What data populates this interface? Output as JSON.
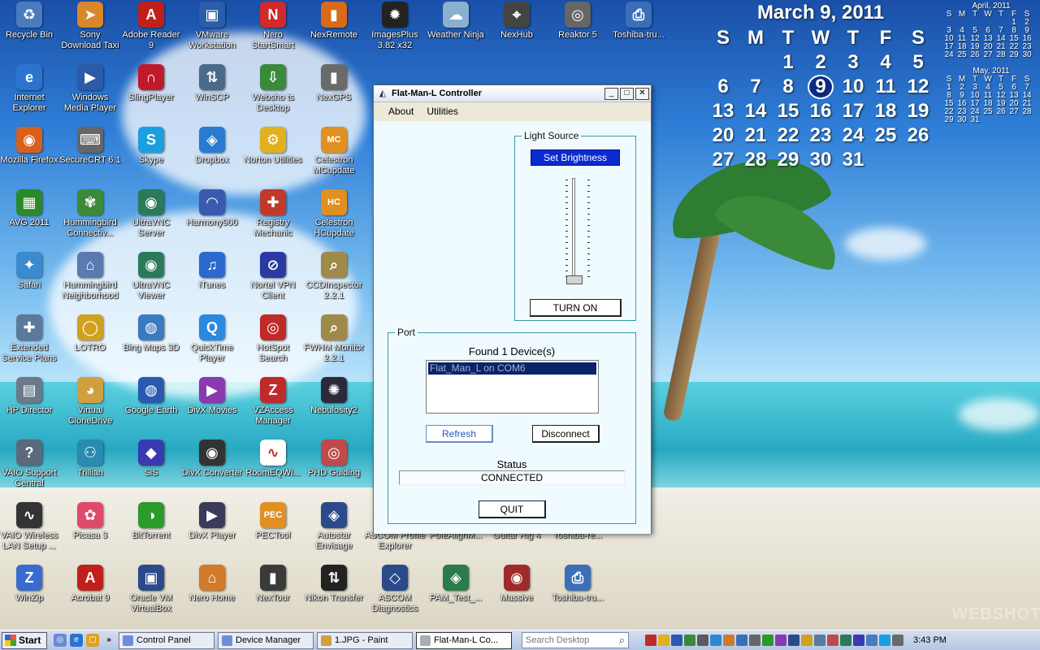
{
  "desktop": {
    "icons": [
      {
        "label": "Recycle Bin",
        "symbol": "♻",
        "color": "#4a7bbf"
      },
      {
        "label": "Sony Download Taxi",
        "symbol": "➤",
        "color": "#d8872a"
      },
      {
        "label": "Adobe Reader 9",
        "symbol": "A",
        "color": "#c0201b"
      },
      {
        "label": "VMware Workstation",
        "symbol": "▣",
        "color": "#2a5ea8"
      },
      {
        "label": "Nero StartSmart",
        "symbol": "N",
        "color": "#d02a2a"
      },
      {
        "label": "NexRemote",
        "symbol": "▮",
        "color": "#d86a1a"
      },
      {
        "label": "ImagesPlus 3.82 x32",
        "symbol": "✹",
        "color": "#222"
      },
      {
        "label": "Weather Ninja",
        "symbol": "☁",
        "color": "#8ab0d0"
      },
      {
        "label": "NexHub",
        "symbol": "⌖",
        "color": "#444"
      },
      {
        "label": "Reaktor 5",
        "symbol": "◎",
        "color": "#666"
      },
      {
        "label": "Toshiba-tru...",
        "symbol": "⎙",
        "color": "#3a6fb8"
      },
      {
        "label": "Internet Explorer",
        "symbol": "e",
        "color": "#2a74d0"
      },
      {
        "label": "Windows Media Player",
        "symbol": "▶",
        "color": "#2a5aa8"
      },
      {
        "label": "SlingPlayer",
        "symbol": "∩",
        "color": "#c01a2a"
      },
      {
        "label": "WinSCP",
        "symbol": "⇅",
        "color": "#4a6a8a"
      },
      {
        "label": "Websho ts Desktop",
        "symbol": "⇩",
        "color": "#3a8a3a"
      },
      {
        "label": "NexGPS",
        "symbol": "▮",
        "color": "#6a6a6a"
      },
      {
        "label": "Mozilla Firefox",
        "symbol": "◉",
        "color": "#d8601a"
      },
      {
        "label": "SecureCRT 6.1",
        "symbol": "⌨",
        "color": "#666"
      },
      {
        "label": "Skype",
        "symbol": "S",
        "color": "#1aa0e0"
      },
      {
        "label": "Dropbox",
        "symbol": "◈",
        "color": "#2a7ad0"
      },
      {
        "label": "Norton Utilities",
        "symbol": "⚙",
        "color": "#e0b020"
      },
      {
        "label": "Celestron MCupdate",
        "symbol": "MC",
        "color": "#e09020"
      },
      {
        "label": "AVG 2011",
        "symbol": "▦",
        "color": "#2a8a2a"
      },
      {
        "label": "Hummingbird Connectiv...",
        "symbol": "✾",
        "color": "#3a8a3a"
      },
      {
        "label": "UltraVNC Server",
        "symbol": "◉",
        "color": "#2a7a5a"
      },
      {
        "label": "Harmony900",
        "symbol": "◠",
        "color": "#3a5ab0"
      },
      {
        "label": "Registry Mechanic",
        "symbol": "✚",
        "color": "#c03a2a"
      },
      {
        "label": "Celestron HCupdate",
        "symbol": "HC",
        "color": "#e09020"
      },
      {
        "label": "Safari",
        "symbol": "✦",
        "color": "#3a8ad0"
      },
      {
        "label": "Hummingbird Neighborhood",
        "symbol": "⌂",
        "color": "#5a7ab0"
      },
      {
        "label": "UltraVNC Viewer",
        "symbol": "◉",
        "color": "#2a7a5a"
      },
      {
        "label": "iTunes",
        "symbol": "♫",
        "color": "#2a6ad0"
      },
      {
        "label": "Nortel VPN Client",
        "symbol": "⊘",
        "color": "#2a3aa0"
      },
      {
        "label": "CCDInspector 2.2.1",
        "symbol": "⌕",
        "color": "#a08a4a"
      },
      {
        "label": "Extended Service Plans",
        "symbol": "✚",
        "color": "#5a7a9a"
      },
      {
        "label": "LOTRO",
        "symbol": "◯",
        "color": "#d0a020"
      },
      {
        "label": "Bing Maps 3D",
        "symbol": "◍",
        "color": "#3a7ac0"
      },
      {
        "label": "QuickTime Player",
        "symbol": "Q",
        "color": "#2a8ae0"
      },
      {
        "label": "HotSpot Search",
        "symbol": "◎",
        "color": "#c02a2a"
      },
      {
        "label": "FWHM Monitor 2.2.1",
        "symbol": "⌕",
        "color": "#a08a4a"
      },
      {
        "label": "HP Director",
        "symbol": "▤",
        "color": "#6a7a8a"
      },
      {
        "label": "Virtual CloneDrive",
        "symbol": "◕",
        "color": "#d0a040"
      },
      {
        "label": "Google Earth",
        "symbol": "◍",
        "color": "#2a5ab0"
      },
      {
        "label": "DivX Movies",
        "symbol": "▶",
        "color": "#8a3ab0"
      },
      {
        "label": "VZAccess Manager",
        "symbol": "Z",
        "color": "#c02a2a"
      },
      {
        "label": "Nebulosity2",
        "symbol": "✺",
        "color": "#2a2a3a"
      },
      {
        "label": "VAIO Support Central",
        "symbol": "?",
        "color": "#5a6a7a"
      },
      {
        "label": "Trillian",
        "symbol": "⚇",
        "color": "#2a8ab0"
      },
      {
        "label": "SiS",
        "symbol": "◆",
        "color": "#3a3ab0"
      },
      {
        "label": "DivX Converter",
        "symbol": "◉",
        "color": "#333"
      },
      {
        "label": "RoomEQWi...",
        "symbol": "∿",
        "color": "#fff"
      },
      {
        "label": "PHD Guiding",
        "symbol": "◎",
        "color": "#c04a4a"
      },
      {
        "label": "VAIO Wireless LAN Setup ...",
        "symbol": "∿",
        "color": "#333"
      },
      {
        "label": "Picasa 3",
        "symbol": "✿",
        "color": "#e04a6a"
      },
      {
        "label": "BitTorrent",
        "symbol": "◑",
        "color": "#2a9a2a"
      },
      {
        "label": "DivX Player",
        "symbol": "▶",
        "color": "#3a3a5a"
      },
      {
        "label": "PECTool",
        "symbol": "PEC",
        "color": "#e09020"
      },
      {
        "label": "Autostar Envisage",
        "symbol": "◈",
        "color": "#2a4a8a"
      },
      {
        "label": "ASCOM Profile Explorer",
        "symbol": "◇",
        "color": "#3a5a9a"
      },
      {
        "label": "PoleAlignM...",
        "symbol": "✶",
        "color": "#5a5a5a"
      },
      {
        "label": "Guitar Rig 4",
        "symbol": "♪",
        "color": "#5a5a5a"
      },
      {
        "label": "Toshiba-re...",
        "symbol": "⎙",
        "color": "#3a6fb8"
      },
      {
        "label": "WinZip",
        "symbol": "Z",
        "color": "#3a6ad0"
      },
      {
        "label": "Acrobat 9",
        "symbol": "A",
        "color": "#c0201b"
      },
      {
        "label": "Oracle VM VirtualBox",
        "symbol": "▣",
        "color": "#2a4a8a"
      },
      {
        "label": "Nero Home",
        "symbol": "⌂",
        "color": "#d07a2a"
      },
      {
        "label": "NexTour",
        "symbol": "▮",
        "color": "#3a3a3a"
      },
      {
        "label": "Nikon Transfer",
        "symbol": "⇅",
        "color": "#222"
      },
      {
        "label": "ASCOM Diagnostics",
        "symbol": "◇",
        "color": "#2a4a8a"
      },
      {
        "label": "PAM_Test_...",
        "symbol": "◈",
        "color": "#2a7a4a"
      },
      {
        "label": "Massive",
        "symbol": "◉",
        "color": "#a02a2a"
      },
      {
        "label": "Toshiba-tru...",
        "symbol": "⎙",
        "color": "#3a6fb8"
      }
    ],
    "partial_labels": [
      "...r...",
      "...r...",
      "...zip",
      "...zip"
    ]
  },
  "calendar": {
    "month_title": "March 9, 2011",
    "weekdays": [
      "S",
      "M",
      "T",
      "W",
      "T",
      "F",
      "S"
    ],
    "days": [
      "",
      "",
      "1",
      "2",
      "3",
      "4",
      "5",
      "6",
      "7",
      "8",
      "9",
      "10",
      "11",
      "12",
      "13",
      "14",
      "15",
      "16",
      "17",
      "18",
      "19",
      "20",
      "21",
      "22",
      "23",
      "24",
      "25",
      "26",
      "27",
      "28",
      "29",
      "30",
      "31"
    ],
    "today": "9",
    "mini_months": [
      {
        "title": "April, 2011",
        "weekdays": [
          "S",
          "M",
          "T",
          "W",
          "T",
          "F",
          "S"
        ],
        "days": [
          "",
          "",
          "",
          "",
          "",
          "1",
          "2",
          "3",
          "4",
          "5",
          "6",
          "7",
          "8",
          "9",
          "10",
          "11",
          "12",
          "13",
          "14",
          "15",
          "16",
          "17",
          "18",
          "19",
          "20",
          "21",
          "22",
          "23",
          "24",
          "25",
          "26",
          "27",
          "28",
          "29",
          "30"
        ]
      },
      {
        "title": "May, 2011",
        "weekdays": [
          "S",
          "M",
          "T",
          "W",
          "T",
          "F",
          "S"
        ],
        "days": [
          "1",
          "2",
          "3",
          "4",
          "5",
          "6",
          "7",
          "8",
          "9",
          "10",
          "11",
          "12",
          "13",
          "14",
          "15",
          "16",
          "17",
          "18",
          "19",
          "20",
          "21",
          "22",
          "23",
          "24",
          "25",
          "26",
          "27",
          "28",
          "29",
          "30",
          "31"
        ]
      }
    ]
  },
  "window": {
    "title": "Flat-Man-L Controller",
    "controls": {
      "minimize": "_",
      "maximize": "□",
      "close": "✕"
    },
    "menu": [
      "About",
      "Utilities"
    ],
    "light_source": {
      "group_title": "Light Source",
      "set_brightness_label": "Set Brightness",
      "brightness_level": 0,
      "turn_on_label": "TURN ON"
    },
    "port": {
      "group_title": "Port",
      "found_text": "Found 1 Device(s)",
      "devices": [
        "Flat_Man_L on COM6"
      ],
      "refresh_label": "Refresh",
      "disconnect_label": "Disconnect",
      "status_label": "Status",
      "status_value": "CONNECTED",
      "quit_label": "QUIT"
    }
  },
  "taskbar": {
    "start_label": "Start",
    "tasks": [
      {
        "label": "Control Panel",
        "active": false
      },
      {
        "label": "Device Manager",
        "active": false
      },
      {
        "label": "1.JPG - Paint",
        "active": false
      },
      {
        "label": "Flat-Man-L Co...",
        "active": true
      }
    ],
    "search_placeholder": "Search Desktop",
    "clock": "3:43 PM"
  },
  "watermark": "WEBSHOTS"
}
